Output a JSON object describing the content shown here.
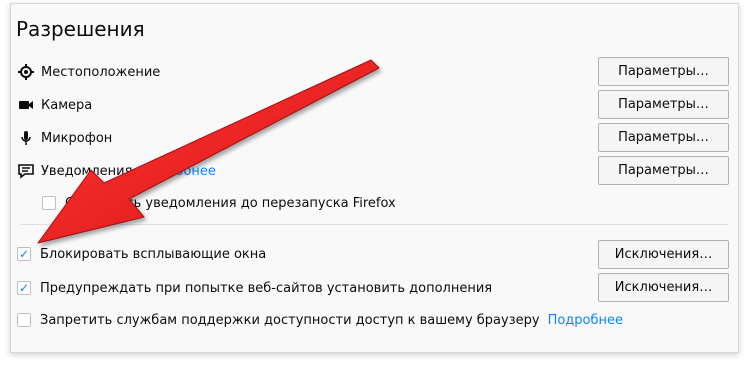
{
  "section": {
    "title": "Разрешения"
  },
  "permissions": [
    {
      "label": "Местоположение",
      "button": "Параметры…",
      "icon": "location-icon"
    },
    {
      "label": "Камера",
      "button": "Параметры…",
      "icon": "camera-icon"
    },
    {
      "label": "Микрофон",
      "button": "Параметры…",
      "icon": "microphone-icon"
    },
    {
      "label": "Уведомления",
      "link": "Подробнее",
      "button": "Параметры…",
      "icon": "notifications-icon"
    }
  ],
  "pause_notifications": {
    "label": "Отключить уведомления до перезапуска Firefox",
    "checked": false
  },
  "block_popups": {
    "label": "Блокировать всплывающие окна",
    "button": "Исключения…",
    "checked": true
  },
  "warn_addons": {
    "label": "Предупреждать при попытке веб-сайтов установить дополнения",
    "button": "Исключения…",
    "checked": true
  },
  "accessibility": {
    "label": "Запретить службам поддержки доступности доступ к вашему браузеру",
    "link": "Подробнее",
    "checked": false
  },
  "colors": {
    "accent": "#0a84ff",
    "arrow": "#e8141b"
  }
}
